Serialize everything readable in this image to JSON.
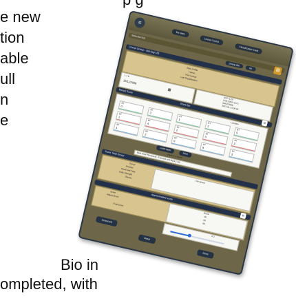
{
  "document": {
    "lines": [
      "e new",
      "tion",
      "able",
      "ull",
      "n",
      "e",
      "Bio in",
      "ompleted, with"
    ],
    "top_fragment": "p g"
  },
  "app": {
    "menu_icon": "hamburger-icon",
    "nav_buttons": [
      "My rates",
      "Lineup Card B",
      "Classification Card"
    ],
    "selection_bar_label": "Selection list",
    "search_tabs": [
      "Lineup Bio",
      "Go"
    ],
    "lineup_header": "Lineup Lineup - Bat bag 155",
    "record": {
      "fields": [
        "Date Profile",
        "Lineup",
        "Print Lineup",
        "Last Classification"
      ],
      "date": "19/11/2008",
      "status_code": "1-1 8",
      "right_values": [
        "ACC-1-29",
        "07/01/2021 (1/7)",
        "03/01/2008",
        "2021-01-14 06:53"
      ],
      "summary_label": "Result Score"
    },
    "grid": {
      "left_header": "Result Score",
      "right_header": "Rank Bio",
      "location_label": "Location",
      "cards": [
        {
          "code": "BT",
          "value": "0"
        },
        {
          "code": "BT",
          "value": "3"
        },
        {
          "code": "BT",
          "value": "1"
        },
        {
          "code": "BT",
          "value": "2"
        },
        {
          "code": "BT",
          "value": "5"
        },
        {
          "code": "BT",
          "value": "1"
        },
        {
          "code": "BT",
          "value": "4"
        },
        {
          "code": "BT",
          "value": "2"
        },
        {
          "code": "BT",
          "value": "0"
        },
        {
          "code": "BT",
          "value": "3"
        },
        {
          "code": "BT",
          "value": "1"
        },
        {
          "code": "BT",
          "value": "2"
        },
        {
          "code": "BT",
          "value": "0"
        },
        {
          "code": "BT",
          "value": "6"
        },
        {
          "code": "BT",
          "value": "3"
        }
      ],
      "buttons": [
        "Load Later",
        "Save"
      ],
      "footer_note": "Rank 8: 3 items",
      "dropdown_label": "Best Total Placement - Forward and Back (1-8)"
    },
    "score_group": {
      "title": "Score Total Group",
      "sub_title": "Tier group",
      "labels": [
        "Group",
        "Bracket",
        "Read and Type",
        "Daily Strength",
        "Source"
      ]
    },
    "approx": {
      "title": "Approximated score",
      "labels": [
        "Score",
        "Adjust Score",
        "Final score"
      ],
      "right_header": "Score",
      "values": [
        "00",
        "00",
        "00"
      ],
      "slider_value": "0.2",
      "slider_level": 0.35
    },
    "footer_buttons": {
      "left": "Scorecard",
      "middle": "Reset",
      "right": "Done"
    },
    "accent": {
      "navy": "#223049",
      "gold": "#d8c48e",
      "olive": "#6d6649",
      "badge": "#d39b2d",
      "stripe_green": "#7cc59c",
      "stripe_red": "#e07a7a",
      "stripe_blue": "#7fb3d8"
    }
  }
}
